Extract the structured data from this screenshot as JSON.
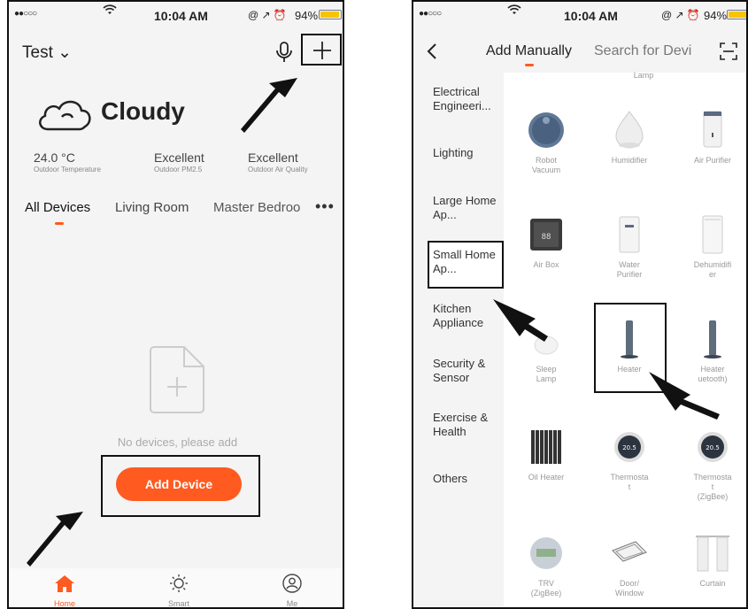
{
  "left": {
    "status": {
      "signal": "●●○○○",
      "time": "10:04 AM",
      "icons": "@ ↗ ⏰",
      "battery": "94%",
      "battery_level": 0.94
    },
    "home_title": "Test ⌄",
    "weather": {
      "condition": "Cloudy",
      "icon": "cloud-icon"
    },
    "stats": [
      {
        "value": "24.0 °C",
        "label": "Outdoor Temperature"
      },
      {
        "value": "Excellent",
        "label": "Outdoor PM2.5"
      },
      {
        "value": "Excellent",
        "label": "Outdoor Air Quality"
      }
    ],
    "tabs": [
      "All Devices",
      "Living Room",
      "Master Bedroo"
    ],
    "more": "•••",
    "empty_text": "No devices, please add",
    "add_device": "Add Device",
    "nav": [
      "Home",
      "Smart",
      "Me"
    ],
    "accent": "#ff5a1f"
  },
  "right": {
    "status": {
      "signal": "●●○○○",
      "time": "10:04 AM",
      "icons": "@ ↗ ⏰",
      "battery": "94%",
      "battery_level": 0.94
    },
    "tabs": [
      "Add Manually",
      "Search for Devi"
    ],
    "categories": [
      "Electrical Engineeri...",
      "Lighting",
      "Large Home Ap...",
      "Small Home Ap...",
      "Kitchen Appliance",
      "Security & Sensor",
      "Exercise & Health",
      "Others"
    ],
    "top_partial": "Lamp",
    "devices": [
      "Robot Vacuum",
      "Humidifier",
      "Air Purifier",
      "Air Box",
      "Water Purifier",
      "Dehumidifier",
      "Sleep Lamp",
      "Heater",
      "Heater (Bluetooth)",
      "Oil Heater",
      "Thermostat",
      "Thermostat (ZigBee)",
      "TRV (ZigBee)",
      "Door/ Window",
      "Curtain"
    ],
    "device_texts": [
      [
        "Robot",
        "Vacuum"
      ],
      [
        "Humidifier"
      ],
      [
        "Air Purifier"
      ],
      [
        "Air Box"
      ],
      [
        "Water",
        "Purifier"
      ],
      [
        "Dehumidifi",
        "er"
      ],
      [
        "Sleep",
        "Lamp"
      ],
      [
        "Heater"
      ],
      [
        "Heater",
        "uetooth)"
      ],
      [
        "Oil Heater"
      ],
      [
        "Thermosta",
        "t"
      ],
      [
        "Thermosta",
        "t",
        "(ZigBee)"
      ],
      [
        "TRV",
        "(ZigBee)"
      ],
      [
        "Door/",
        "Window"
      ],
      [
        "Curtain"
      ]
    ],
    "thermostat_reading": "20.5",
    "airbox_reading": "88"
  }
}
